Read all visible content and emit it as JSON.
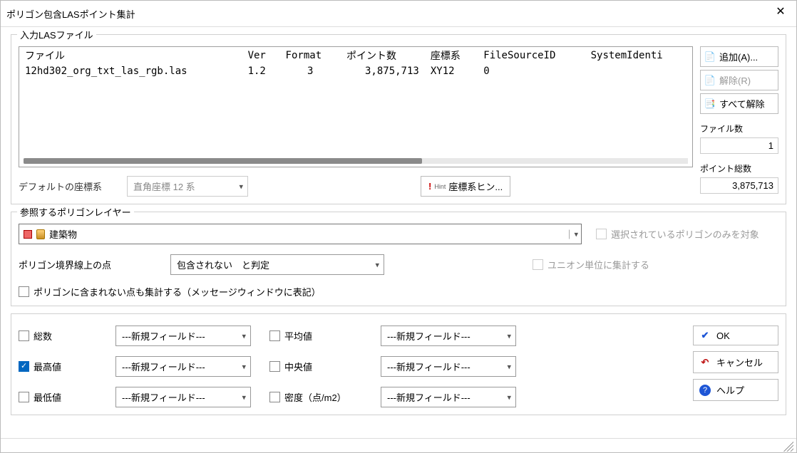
{
  "window": {
    "title": "ポリゴン包含LASポイント集計"
  },
  "las": {
    "legend": "入力LASファイル",
    "headers": [
      "ファイル",
      "Ver",
      "Format",
      "ポイント数",
      "座標系",
      "FileSourceID",
      "SystemIdenti"
    ],
    "rows": [
      {
        "file": "12hd302_org_txt_las_rgb.las",
        "ver": "1.2",
        "format": "3",
        "points": "3,875,713",
        "crs": "XY12",
        "fsid": "0",
        "sysid": ""
      }
    ],
    "crsLabel": "デフォルトの座標系",
    "crsValue": "直角座標 12 系",
    "hintBtn": "座標系ヒン...",
    "btnAdd": "追加(A)...",
    "btnRemove": "解除(R)",
    "btnRemoveAll": "すべて解除",
    "fileCountLabel": "ファイル数",
    "fileCount": "1",
    "pointTotalLabel": "ポイント総数",
    "pointTotal": "3,875,713"
  },
  "poly": {
    "legend": "参照するポリゴンレイヤー",
    "layer": "建築物",
    "chkSelectedOnly": "選択されているポリゴンのみを対象",
    "chkUnion": "ユニオン単位に集計する",
    "boundaryLabel": "ポリゴン境界線上の点",
    "boundaryValue": "包含されない　と判定",
    "chkOutside": "ポリゴンに含まれない点も集計する（メッセージウィンドウに表記）"
  },
  "out": {
    "combo": "---新規フィールド---",
    "chkTotal": "総数",
    "chkMax": "最高値",
    "chkMin": "最低値",
    "chkAvg": "平均値",
    "chkMed": "中央値",
    "chkDensity": "密度（点/m2）",
    "btnOk": "OK",
    "btnCancel": "キャンセル",
    "btnHelp": "ヘルプ"
  }
}
